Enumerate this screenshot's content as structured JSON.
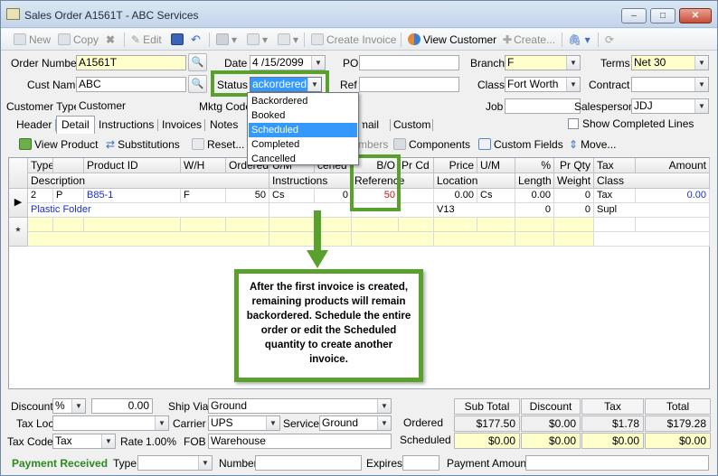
{
  "window": {
    "title": "Sales Order A1561T - ABC Services",
    "minimize": "–",
    "maximize": "□",
    "close": "✕"
  },
  "toolbar": {
    "new": "New",
    "copy": "Copy",
    "edit": "Edit",
    "create_invoice": "Create Invoice",
    "view_customer": "View Customer",
    "create": "Create..."
  },
  "header": {
    "order_number_label": "Order Number",
    "order_number": "A1561T",
    "date_label": "Date",
    "date": "4 /15/2099",
    "po_label": "PO",
    "po": "",
    "branch_label": "Branch",
    "branch": "F",
    "terms_label": "Terms",
    "terms": "Net 30",
    "cust_name_label": "Cust Name",
    "cust_name": "ABC",
    "status_label": "Status",
    "status": "ackordered",
    "ref_label": "Ref",
    "ref": "",
    "class_label": "Class",
    "class": "Fort Worth",
    "contract_label": "Contract",
    "contract": "",
    "customer_type_label": "Customer Type",
    "customer_type": "Customer",
    "mktg_code_label": "Mktg Code",
    "job_label": "Job",
    "job": "",
    "salesperson_label": "Salesperson",
    "salesperson": "JDJ"
  },
  "status_options": [
    "Backordered",
    "Booked",
    "Scheduled",
    "Completed",
    "Cancelled"
  ],
  "status_selected_index": 2,
  "tabs": [
    "Header",
    "Detail",
    "Instructions",
    "Invoices",
    "Notes",
    "Email",
    "Custom"
  ],
  "active_tab": "Detail",
  "show_completed_lines": "Show Completed Lines",
  "subtoolbar": {
    "view_product": "View Product",
    "substitutions": "Substitutions",
    "reset": "Reset...",
    "numbers": "mbers",
    "components": "Components",
    "custom_fields": "Custom Fields",
    "move": "Move..."
  },
  "grid": {
    "header_row1": [
      "Type",
      "Product ID",
      "W/H",
      "Ordered",
      "U/M",
      "cened",
      "B/O",
      "Pr Cd",
      "Price",
      "U/M",
      "%",
      "Pr Qty",
      "Tax",
      "Amount"
    ],
    "header_row2": [
      "Description",
      "Instructions",
      "Reference",
      "Location",
      "Length",
      "Weight",
      "Class"
    ],
    "row": {
      "line": "2",
      "type": "P",
      "product_id": "B85-1",
      "wh": "F",
      "ordered": "50",
      "um": "Cs",
      "licensed": "0",
      "bo": "50",
      "price": "0.00",
      "price_um": "Cs",
      "pct": "0.00",
      "pr_qty": "0",
      "tax": "Tax",
      "amount": "0.00",
      "description": "Plastic Folder",
      "location": "V13",
      "length": "0",
      "weight": "0",
      "class": "Supl"
    },
    "new_row_marker": "*",
    "current_row_marker": "▶"
  },
  "callout": "After the first invoice is created, remaining products will remain backordered. Schedule the entire order or edit the Scheduled quantity to create another invoice.",
  "footer": {
    "discount_label": "Discount",
    "discount_type": "%",
    "discount_value": "0.00",
    "ship_via_label": "Ship Via",
    "ship_via": "Ground",
    "tax_loc_label": "Tax Loc",
    "tax_loc": "",
    "carrier_label": "Carrier",
    "carrier": "UPS",
    "service_label": "Service",
    "service": "Ground",
    "tax_code_label": "Tax Code",
    "tax_code": "Tax",
    "rate_label": "Rate",
    "rate": "1.00%",
    "fob_label": "FOB",
    "fob": "Warehouse",
    "payment_received_label": "Payment Received",
    "type_label": "Type",
    "number_label": "Number",
    "expires_label": "Expires",
    "payment_amount_label": "Payment Amount"
  },
  "totals": {
    "headers": [
      "Sub Total",
      "Discount",
      "Tax",
      "Total"
    ],
    "ordered_label": "Ordered",
    "ordered": [
      "$177.50",
      "$0.00",
      "$1.78",
      "$179.28"
    ],
    "scheduled_label": "Scheduled",
    "scheduled": [
      "$0.00",
      "$0.00",
      "$0.00",
      "$0.00"
    ]
  },
  "colors": {
    "highlight_green": "#5aa02c",
    "selected_blue": "#3399ff",
    "yellow_field": "#ffffcc",
    "link_blue": "#1a2fcb",
    "backorder_red": "#d11414"
  }
}
